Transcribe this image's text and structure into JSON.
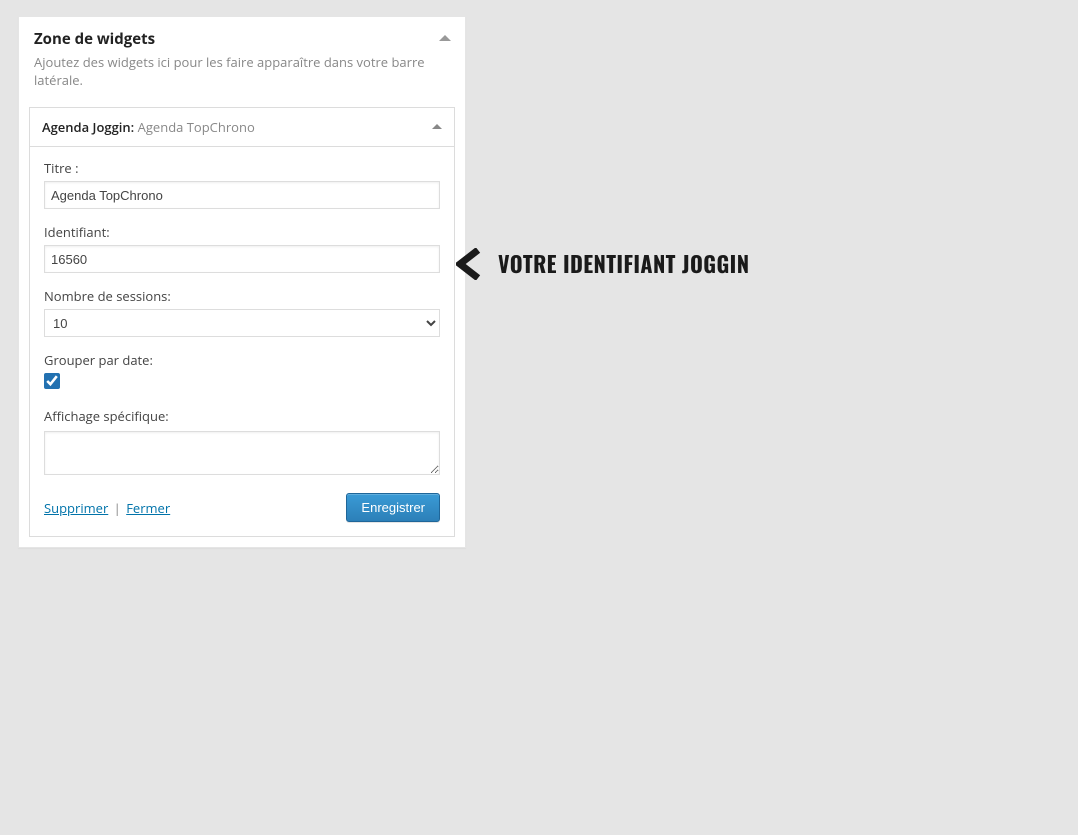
{
  "zone": {
    "title": "Zone de widgets",
    "description": "Ajoutez des widgets ici pour les faire apparaître dans votre barre latérale."
  },
  "widget": {
    "name": "Agenda Joggin:",
    "subtitle": "Agenda TopChrono",
    "fields": {
      "title_label": "Titre :",
      "title_value": "Agenda TopChrono",
      "id_label": "Identifiant:",
      "id_value": "16560",
      "sessions_label": "Nombre de sessions:",
      "sessions_value": "10",
      "groupdate_label": "Grouper par date:",
      "groupdate_checked": true,
      "specific_label": "Affichage spécifique:",
      "specific_value": ""
    },
    "actions": {
      "delete": "Supprimer",
      "separator": "|",
      "close": "Fermer",
      "save": "Enregistrer"
    }
  },
  "annotation": {
    "text": "VOTRE IDENTIFIANT JOGGIN"
  }
}
